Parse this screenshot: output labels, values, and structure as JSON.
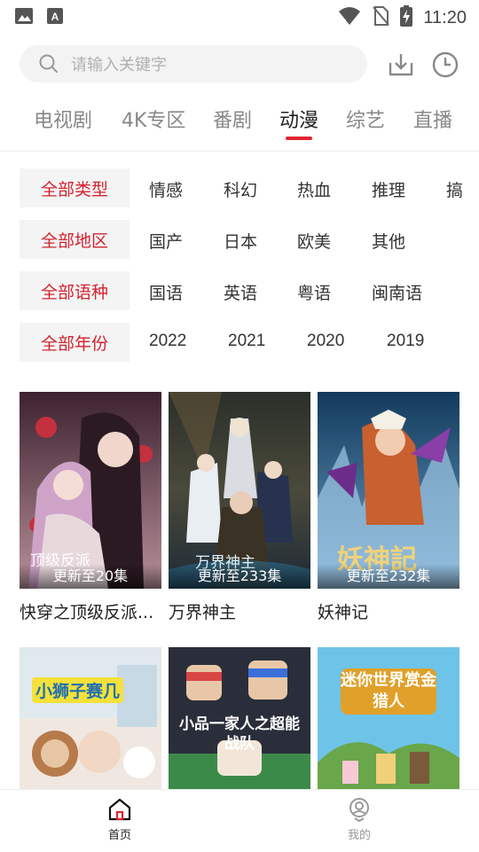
{
  "status": {
    "time": "11:20"
  },
  "search": {
    "placeholder": "请输入关键字"
  },
  "tabs": [
    {
      "label": "电视剧"
    },
    {
      "label": "4K专区"
    },
    {
      "label": "番剧"
    },
    {
      "label": "动漫",
      "active": true
    },
    {
      "label": "综艺"
    },
    {
      "label": "直播"
    }
  ],
  "filters": {
    "type": {
      "selected": "全部类型",
      "options": [
        "情感",
        "科幻",
        "热血",
        "推理",
        "搞"
      ]
    },
    "region": {
      "selected": "全部地区",
      "options": [
        "国产",
        "日本",
        "欧美",
        "其他"
      ]
    },
    "language": {
      "selected": "全部语种",
      "options": [
        "国语",
        "英语",
        "粤语",
        "闽南语"
      ]
    },
    "year": {
      "selected": "全部年份",
      "options": [
        "2022",
        "2021",
        "2020",
        "2019"
      ]
    }
  },
  "cards": [
    {
      "title": "快穿之顶级反派...",
      "badge": "更新至20集",
      "art_text": "顶级反派"
    },
    {
      "title": "万界神主",
      "badge": "更新至233集",
      "art_text": "万界神主"
    },
    {
      "title": "妖神记",
      "badge": "更新至232集",
      "art_text": "妖神記"
    },
    {
      "art_text": "小狮子赛几"
    },
    {
      "art_text": "小品一家人之超能战队"
    },
    {
      "art_text": "迷你世界赏金猎人"
    }
  ],
  "bottom_nav": [
    {
      "label": "首页",
      "active": true
    },
    {
      "label": "我的"
    }
  ],
  "colors": {
    "accent": "#e0262f",
    "filter_selected_text": "#d32330",
    "chip_bg": "#f4f4f4"
  }
}
